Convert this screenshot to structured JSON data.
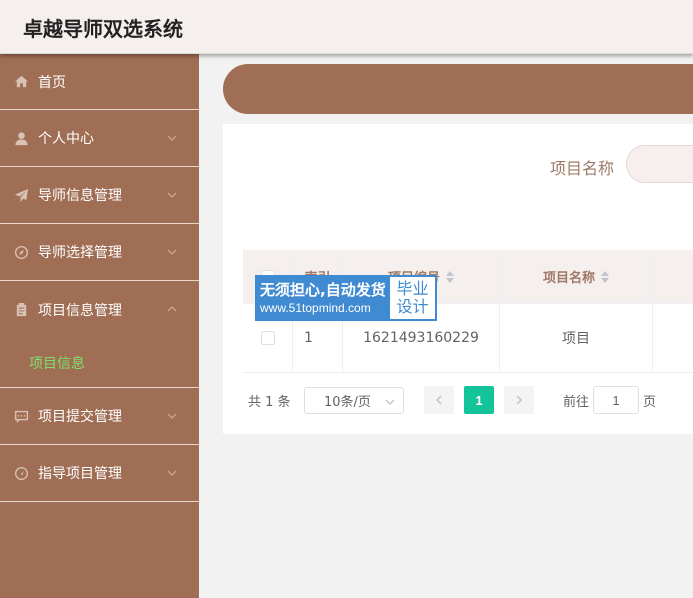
{
  "app": {
    "title": "卓越导师双选系统"
  },
  "sidebar": {
    "items": [
      {
        "label": "首页",
        "icon": "home-icon"
      },
      {
        "label": "个人中心",
        "icon": "user-icon"
      },
      {
        "label": "导师信息管理",
        "icon": "send-icon"
      },
      {
        "label": "导师选择管理",
        "icon": "compass-icon"
      },
      {
        "label": "项目信息管理",
        "icon": "clipboard-icon",
        "expanded": true,
        "children": [
          {
            "label": "项目信息",
            "active": true
          }
        ]
      },
      {
        "label": "项目提交管理",
        "icon": "chat-icon"
      },
      {
        "label": "指导项目管理",
        "icon": "gauge-icon"
      }
    ]
  },
  "search": {
    "label": "项目名称",
    "value": ""
  },
  "table": {
    "columns": [
      "",
      "索引",
      "项目编号",
      "项目名称"
    ],
    "rows": [
      {
        "index": "1",
        "number": "1621493160229",
        "name": "项目"
      }
    ]
  },
  "pagination": {
    "total": "共 1 条",
    "page_size": "10条/页",
    "current_page": "1",
    "goto_prefix": "前往",
    "goto_value": "1",
    "goto_suffix": "页"
  },
  "watermark": {
    "line1": "无须担心,自动发货",
    "line2": "www.51topmind.com",
    "badge_line1": "毕业",
    "badge_line2": "设计"
  },
  "colors": {
    "primary": "#a06e55",
    "active_menu": "#7fe06a",
    "page_active": "#13c39a",
    "header_bg": "#f5efed"
  }
}
